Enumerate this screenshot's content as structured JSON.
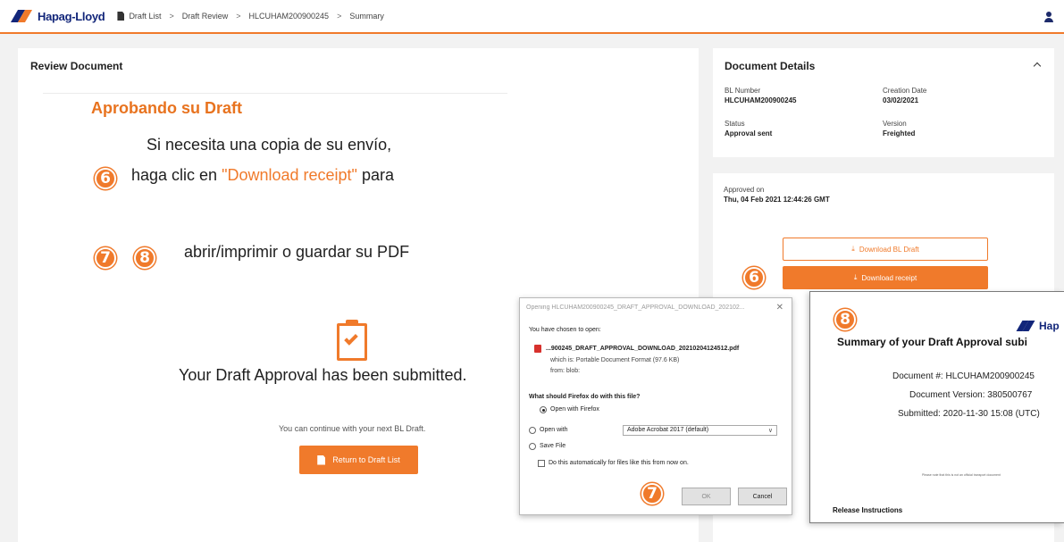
{
  "brand": {
    "logo_text": "Hapag-Lloyd"
  },
  "breadcrumb": [
    "Draft List",
    "Draft Review",
    "HLCUHAM200900245",
    "Summary"
  ],
  "review": {
    "title": "Review Document",
    "overlay_title": "Aprobando su Draft",
    "overlay_line1": "Si necesita una copia de su envío,",
    "overlay_line2_pre": "haga clic en ",
    "overlay_line2_highlight": "\"Download receipt\"",
    "overlay_line2_post": " para",
    "overlay_line3": "abrir/imprimir o guardar su PDF",
    "submitted_text": "Your Draft Approval has been submitted.",
    "continue_text": "You can continue with your next BL Draft.",
    "return_button": "Return to Draft List"
  },
  "badges": {
    "six": "6",
    "seven": "7",
    "eight": "8"
  },
  "details": {
    "title": "Document Details",
    "bl_number_label": "BL Number",
    "bl_number": "HLCUHAM200900245",
    "creation_date_label": "Creation Date",
    "creation_date": "03/02/2021",
    "status_label": "Status",
    "status": "Approval sent",
    "version_label": "Version",
    "version": "Freighted"
  },
  "approval": {
    "approved_on_label": "Approved on",
    "approved_on": "Thu, 04 Feb 2021 12:44:26 GMT",
    "download_bl_draft": "Download BL Draft",
    "download_receipt": "Download receipt"
  },
  "dialog": {
    "title": "Opening HLCUHAM200900245_DRAFT_APPROVAL_DOWNLOAD_202102...",
    "chosen": "You have chosen to open:",
    "filename": "...900245_DRAFT_APPROVAL_DOWNLOAD_20210204124512.pdf",
    "which_is": "which is: Portable Document Format (97.6 KB)",
    "from": "from: blob:",
    "question": "What should Firefox do with this file?",
    "open_firefox": "Open with Firefox",
    "open_with": "Open with",
    "open_with_value": "Adobe Acrobat 2017 (default)",
    "save_file": "Save File",
    "auto": "Do this automatically for files like this from now on.",
    "ok": "OK",
    "cancel": "Cancel"
  },
  "summary_doc": {
    "logo_text": "Hap",
    "title": "Summary of your Draft Approval subi",
    "document_no": "Document #: HLCUHAM200900245",
    "document_version": "Document Version: 380500767",
    "submitted": "Submitted: 2020-11-30 15:08 (UTC)",
    "disclaimer": "Please note that this is not an official transport document",
    "release": "Release Instructions"
  },
  "colors": {
    "accent": "#f07a2b",
    "brand_blue": "#12267a"
  }
}
